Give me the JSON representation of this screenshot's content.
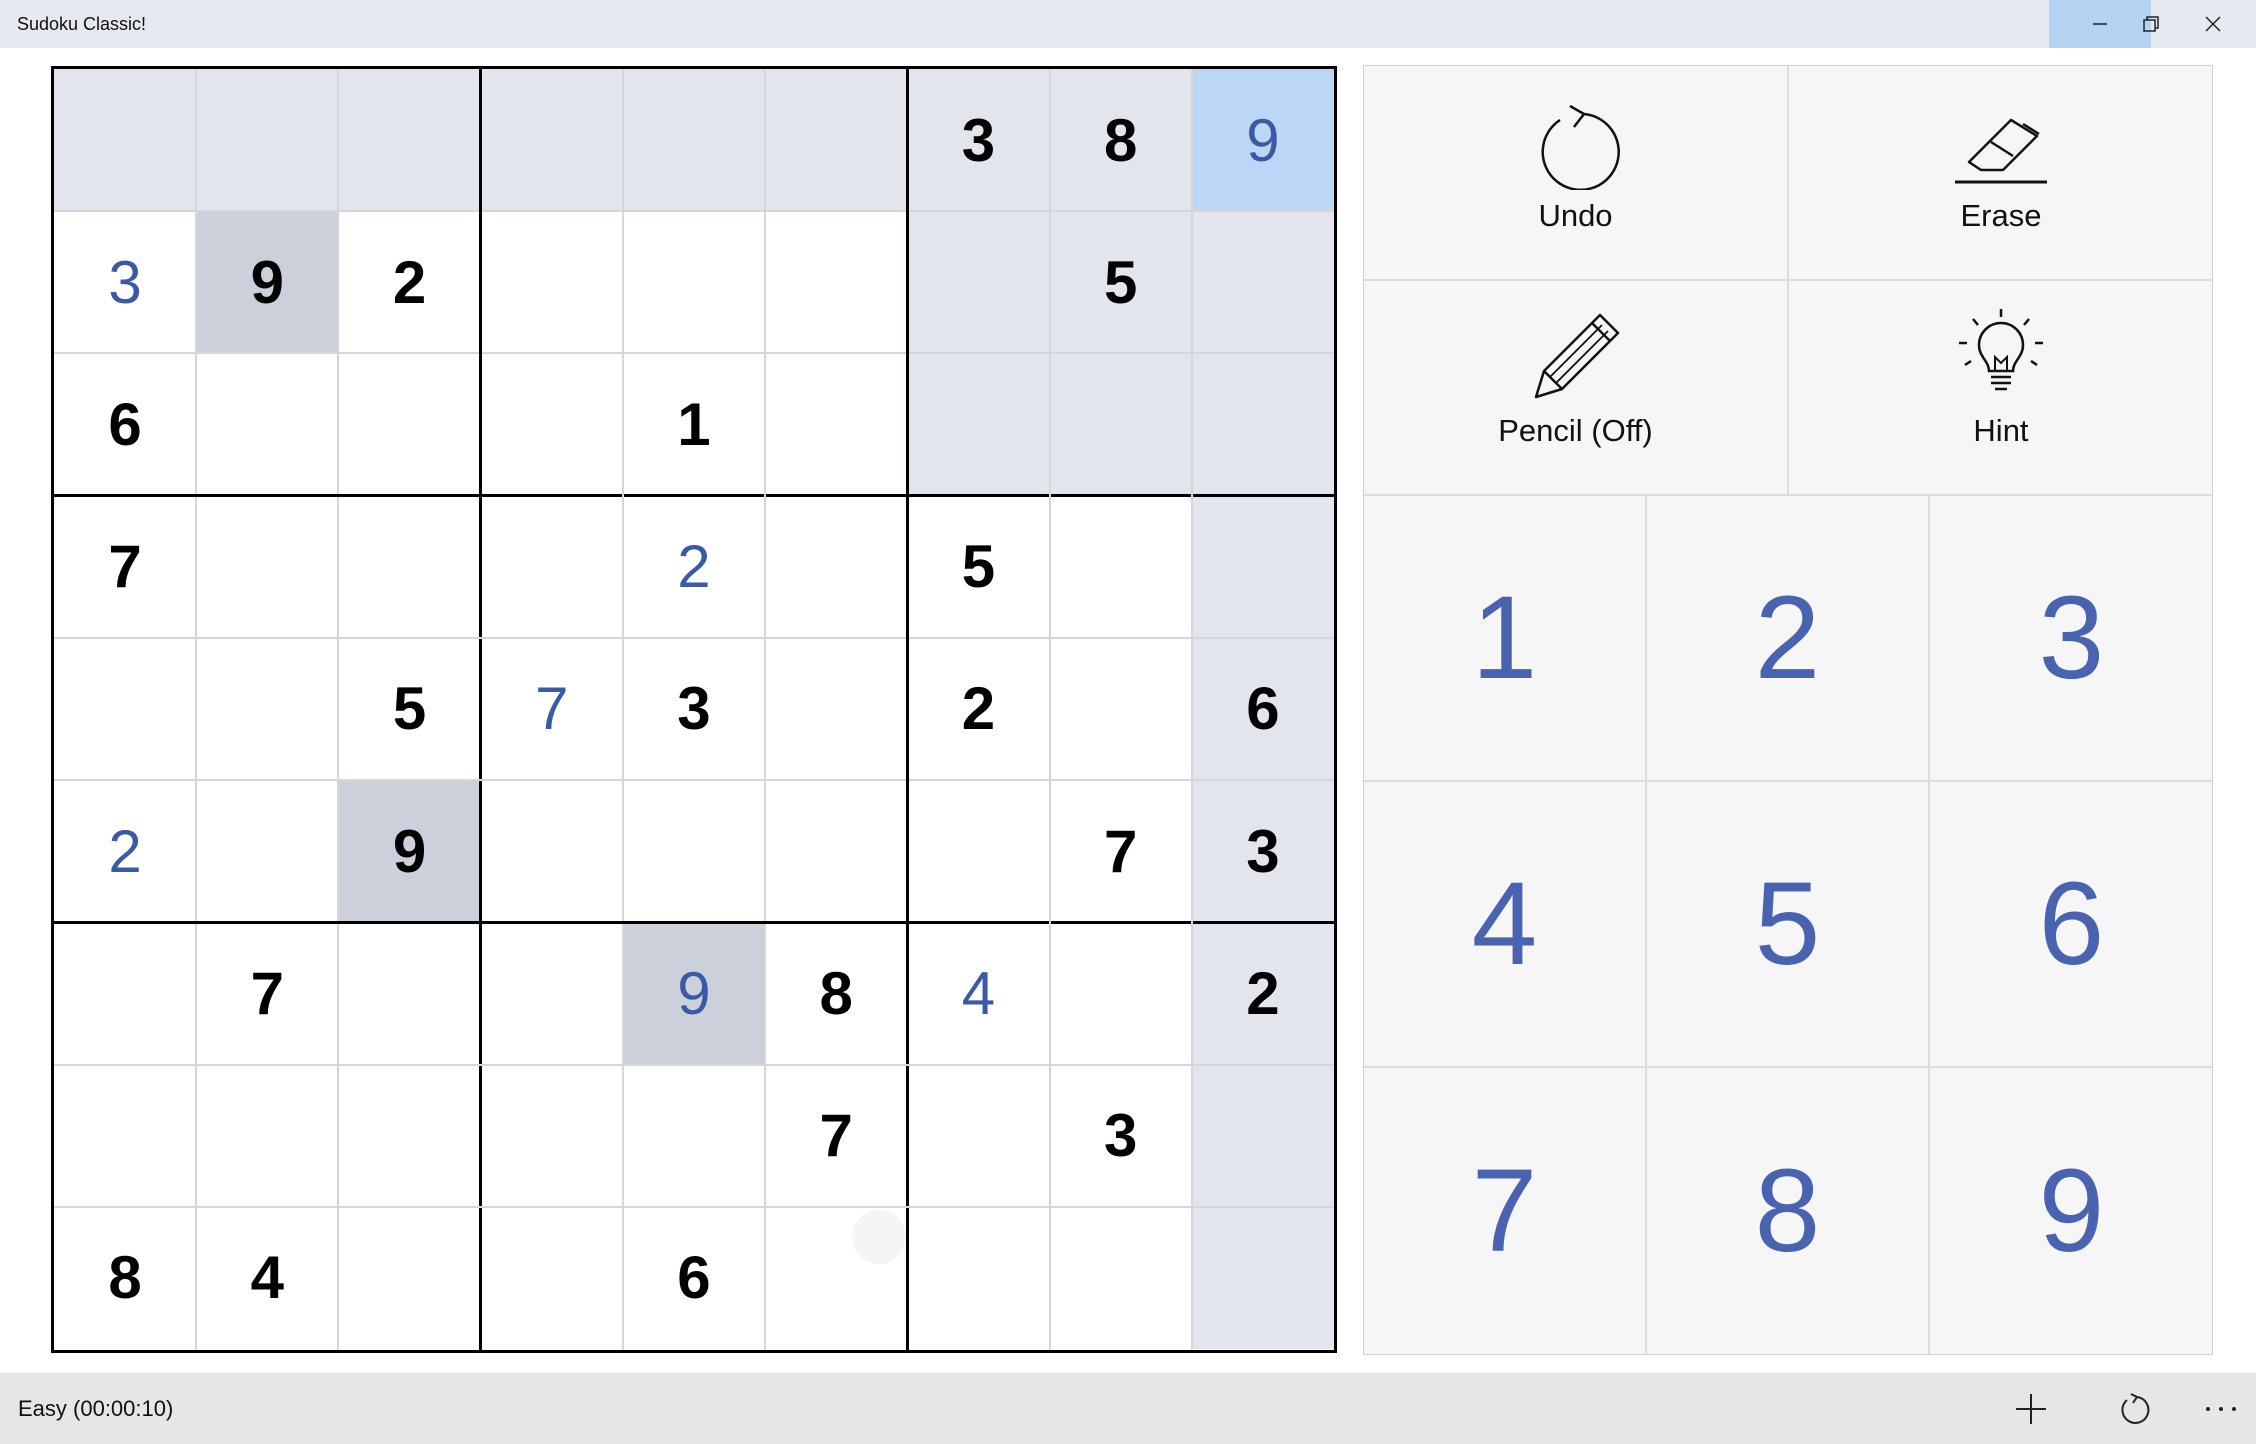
{
  "window": {
    "title": "Sudoku Classic!",
    "controls": [
      "minimize-icon",
      "restore-icon",
      "close-icon"
    ]
  },
  "board": {
    "rows": [
      [
        {
          "value": "",
          "kind": "empty",
          "state": "row-highlight"
        },
        {
          "value": "",
          "kind": "empty",
          "state": "row-highlight"
        },
        {
          "value": "",
          "kind": "empty",
          "state": "row-highlight"
        },
        {
          "value": "",
          "kind": "empty",
          "state": "row-highlight"
        },
        {
          "value": "",
          "kind": "empty",
          "state": "row-highlight"
        },
        {
          "value": "",
          "kind": "empty",
          "state": "row-highlight"
        },
        {
          "value": "3",
          "kind": "given",
          "state": "row-highlight"
        },
        {
          "value": "8",
          "kind": "given",
          "state": "row-highlight"
        },
        {
          "value": "9",
          "kind": "user",
          "state": "selected"
        }
      ],
      [
        {
          "value": "3",
          "kind": "user",
          "state": ""
        },
        {
          "value": "9",
          "kind": "given",
          "state": "same-number"
        },
        {
          "value": "2",
          "kind": "given",
          "state": ""
        },
        {
          "value": "",
          "kind": "empty",
          "state": ""
        },
        {
          "value": "",
          "kind": "empty",
          "state": ""
        },
        {
          "value": "",
          "kind": "empty",
          "state": ""
        },
        {
          "value": "",
          "kind": "empty",
          "state": "box-highlight"
        },
        {
          "value": "5",
          "kind": "given",
          "state": "box-highlight"
        },
        {
          "value": "",
          "kind": "empty",
          "state": "col-highlight"
        }
      ],
      [
        {
          "value": "6",
          "kind": "given",
          "state": ""
        },
        {
          "value": "",
          "kind": "empty",
          "state": ""
        },
        {
          "value": "",
          "kind": "empty",
          "state": ""
        },
        {
          "value": "",
          "kind": "empty",
          "state": ""
        },
        {
          "value": "1",
          "kind": "given",
          "state": ""
        },
        {
          "value": "",
          "kind": "empty",
          "state": ""
        },
        {
          "value": "",
          "kind": "empty",
          "state": "box-highlight"
        },
        {
          "value": "",
          "kind": "empty",
          "state": "box-highlight"
        },
        {
          "value": "",
          "kind": "empty",
          "state": "col-highlight"
        }
      ],
      [
        {
          "value": "7",
          "kind": "given",
          "state": ""
        },
        {
          "value": "",
          "kind": "empty",
          "state": ""
        },
        {
          "value": "",
          "kind": "empty",
          "state": ""
        },
        {
          "value": "",
          "kind": "empty",
          "state": ""
        },
        {
          "value": "2",
          "kind": "user",
          "state": ""
        },
        {
          "value": "",
          "kind": "empty",
          "state": ""
        },
        {
          "value": "5",
          "kind": "given",
          "state": ""
        },
        {
          "value": "",
          "kind": "empty",
          "state": ""
        },
        {
          "value": "",
          "kind": "empty",
          "state": "col-highlight"
        }
      ],
      [
        {
          "value": "",
          "kind": "empty",
          "state": ""
        },
        {
          "value": "",
          "kind": "empty",
          "state": ""
        },
        {
          "value": "5",
          "kind": "given",
          "state": ""
        },
        {
          "value": "7",
          "kind": "user",
          "state": ""
        },
        {
          "value": "3",
          "kind": "given",
          "state": ""
        },
        {
          "value": "",
          "kind": "empty",
          "state": ""
        },
        {
          "value": "2",
          "kind": "given",
          "state": ""
        },
        {
          "value": "",
          "kind": "empty",
          "state": ""
        },
        {
          "value": "6",
          "kind": "given",
          "state": "col-highlight"
        }
      ],
      [
        {
          "value": "2",
          "kind": "user",
          "state": ""
        },
        {
          "value": "",
          "kind": "empty",
          "state": ""
        },
        {
          "value": "9",
          "kind": "given",
          "state": "same-number"
        },
        {
          "value": "",
          "kind": "empty",
          "state": ""
        },
        {
          "value": "",
          "kind": "empty",
          "state": ""
        },
        {
          "value": "",
          "kind": "empty",
          "state": ""
        },
        {
          "value": "",
          "kind": "empty",
          "state": ""
        },
        {
          "value": "7",
          "kind": "given",
          "state": ""
        },
        {
          "value": "3",
          "kind": "given",
          "state": "col-highlight"
        }
      ],
      [
        {
          "value": "",
          "kind": "empty",
          "state": ""
        },
        {
          "value": "7",
          "kind": "given",
          "state": ""
        },
        {
          "value": "",
          "kind": "empty",
          "state": ""
        },
        {
          "value": "",
          "kind": "empty",
          "state": ""
        },
        {
          "value": "9",
          "kind": "user",
          "state": "same-number"
        },
        {
          "value": "8",
          "kind": "given",
          "state": ""
        },
        {
          "value": "4",
          "kind": "user",
          "state": ""
        },
        {
          "value": "",
          "kind": "empty",
          "state": ""
        },
        {
          "value": "2",
          "kind": "given",
          "state": "col-highlight"
        }
      ],
      [
        {
          "value": "",
          "kind": "empty",
          "state": ""
        },
        {
          "value": "",
          "kind": "empty",
          "state": ""
        },
        {
          "value": "",
          "kind": "empty",
          "state": ""
        },
        {
          "value": "",
          "kind": "empty",
          "state": ""
        },
        {
          "value": "",
          "kind": "empty",
          "state": ""
        },
        {
          "value": "7",
          "kind": "given",
          "state": ""
        },
        {
          "value": "",
          "kind": "empty",
          "state": ""
        },
        {
          "value": "3",
          "kind": "given",
          "state": ""
        },
        {
          "value": "",
          "kind": "empty",
          "state": "col-highlight"
        }
      ],
      [
        {
          "value": "8",
          "kind": "given",
          "state": ""
        },
        {
          "value": "4",
          "kind": "given",
          "state": ""
        },
        {
          "value": "",
          "kind": "empty",
          "state": ""
        },
        {
          "value": "",
          "kind": "empty",
          "state": ""
        },
        {
          "value": "6",
          "kind": "given",
          "state": ""
        },
        {
          "value": "",
          "kind": "empty",
          "state": ""
        },
        {
          "value": "",
          "kind": "empty",
          "state": ""
        },
        {
          "value": "",
          "kind": "empty",
          "state": ""
        },
        {
          "value": "",
          "kind": "empty",
          "state": "col-highlight"
        }
      ]
    ],
    "colors": {
      "given": "#000000",
      "user": "#3a5aa8",
      "selected": "#bcd6f6",
      "row-highlight": "#e2e5eb",
      "col-highlight": "#e2e5eb",
      "box-highlight": "#e2e5eb",
      "same-number": "#cbd0da"
    }
  },
  "controls": {
    "undo": {
      "label": "Undo",
      "icon": "undo-icon"
    },
    "erase": {
      "label": "Erase",
      "icon": "eraser-icon"
    },
    "pencil": {
      "label": "Pencil (Off)",
      "icon": "pencil-icon"
    },
    "hint": {
      "label": "Hint",
      "icon": "lightbulb-icon"
    },
    "numbers": [
      "1",
      "2",
      "3",
      "4",
      "5",
      "6",
      "7",
      "8",
      "9"
    ],
    "number_color": "#4a63b0"
  },
  "status": {
    "text": "Easy (00:00:10)",
    "actions": [
      "new-game-plus-icon",
      "restart-icon",
      "more-options-icon"
    ]
  }
}
